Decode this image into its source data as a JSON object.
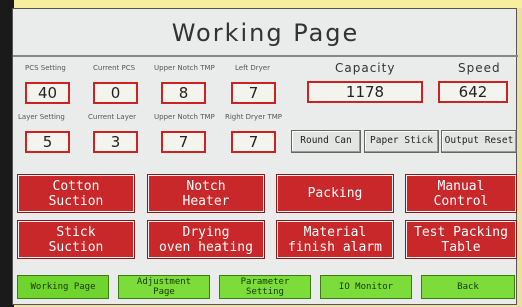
{
  "window": {
    "title": "Working Page"
  },
  "fields": {
    "pcs_setting": {
      "label": "PCS Setting",
      "value": "40"
    },
    "current_pcs": {
      "label": "Current PCS",
      "value": "0"
    },
    "upper_notch_tmp_1": {
      "label": "Upper Notch TMP",
      "value": "8"
    },
    "left_dryer": {
      "label": "Left Dryer",
      "value": "7"
    },
    "capacity": {
      "label": "Capacity",
      "value": "1178"
    },
    "speed": {
      "label": "Speed",
      "value": "642"
    },
    "layer_setting": {
      "label": "Layer Setting",
      "value": "5"
    },
    "current_layer": {
      "label": "Current Layer",
      "value": "3"
    },
    "upper_notch_tmp_2": {
      "label": "Upper Notch TMP",
      "value": "7"
    },
    "right_dryer_tmp": {
      "label": "Right Dryer TMP",
      "value": "7"
    }
  },
  "mode_buttons": {
    "round_can": "Round Can",
    "paper_stick": "Paper Stick",
    "output_reset": "Output Reset"
  },
  "controls": [
    {
      "label": "Cotton\nSuction"
    },
    {
      "label": "Notch\nHeater"
    },
    {
      "label": "Packing"
    },
    {
      "label": "Manual\nControl"
    },
    {
      "label": "Stick\nSuction"
    },
    {
      "label": "Drying\noven heating"
    },
    {
      "label": "Material\nfinish alarm"
    },
    {
      "label": "Test Packing\nTable"
    }
  ],
  "nav": [
    {
      "label": "Working Page"
    },
    {
      "label": "Adjustment\nPage"
    },
    {
      "label": "Parameter\nSetting"
    },
    {
      "label": "IO Monitor"
    },
    {
      "label": "Back"
    }
  ],
  "colors": {
    "control_red": "#c8282a",
    "nav_green": "#7bdc3a",
    "value_border": "#cc2222"
  }
}
